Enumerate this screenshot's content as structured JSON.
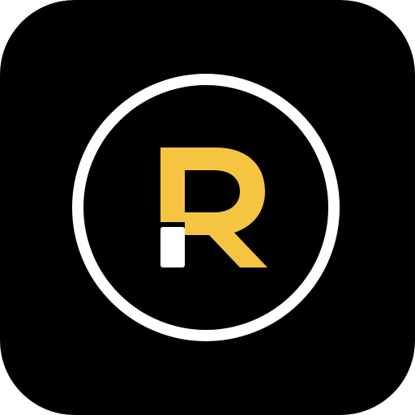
{
  "app_icon": {
    "name": "R",
    "description_text": "",
    "colors": {
      "tile_background": "#000000",
      "page_background": "#ffffff",
      "ring": "#ffffff",
      "letter_primary": "#f5c542",
      "letter_accent": "#ffffff"
    }
  }
}
